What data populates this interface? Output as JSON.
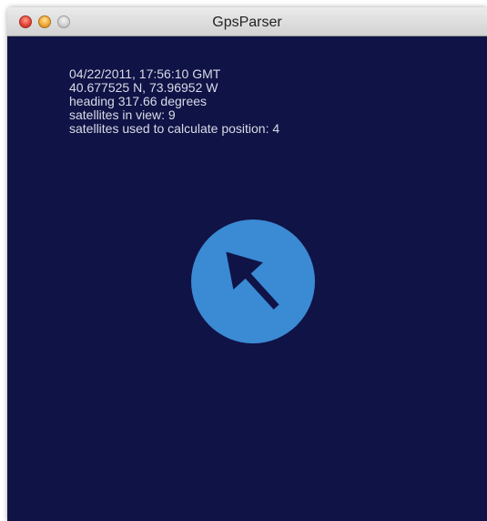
{
  "window": {
    "title": "GpsParser"
  },
  "info": {
    "datetime": "04/22/2011, 17:56:10 GMT",
    "position": "40.677525 N, 73.96952 W",
    "heading": "heading 317.66 degrees",
    "satellites_in_view": "satellites in view: 9",
    "satellites_used": "satellites used to calculate position: 4"
  },
  "compass": {
    "icon": "heading-arrow-icon",
    "heading_degrees": 317.66,
    "circle_color": "#3b8ad4",
    "arrow_color": "#101346"
  },
  "colors": {
    "background": "#101346",
    "text": "#d9dbe6"
  }
}
